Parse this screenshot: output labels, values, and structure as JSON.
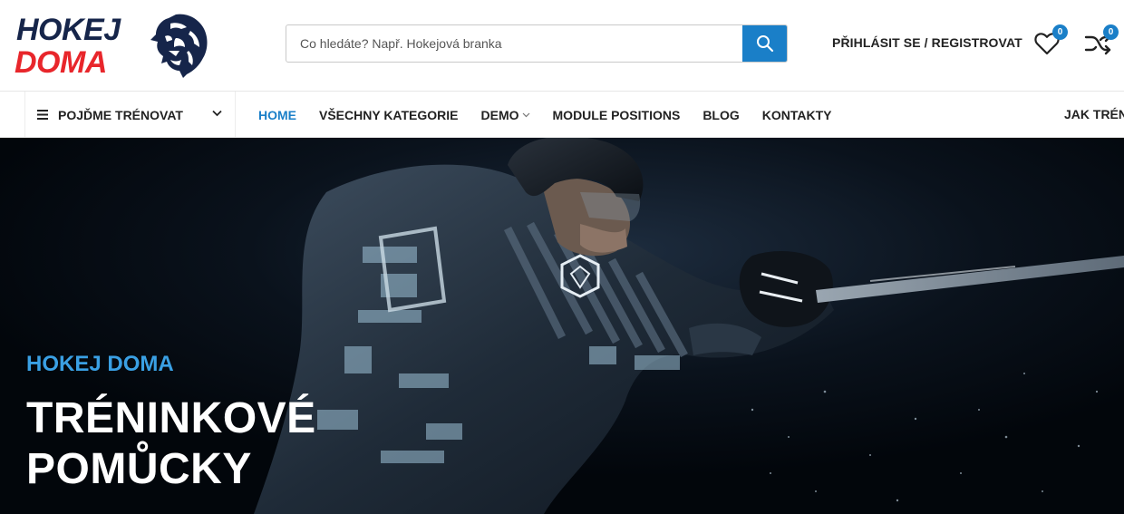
{
  "header": {
    "logo": {
      "line1": "HOKEJ",
      "line2": "DOMA",
      "mark_icon": "lion-head-icon"
    },
    "search": {
      "placeholder": "Co hledáte? Např. Hokejová branka",
      "button_icon": "search-icon"
    },
    "login_label": "PŘIHLÁSIT SE / REGISTROVAT",
    "wishlist": {
      "icon": "heart-icon",
      "count": "0"
    },
    "compare": {
      "icon": "shuffle-icon",
      "count": "0"
    }
  },
  "nav": {
    "categories_label": "POJĎME TRÉNOVAT",
    "items": [
      {
        "label": "HOME",
        "active": true
      },
      {
        "label": "VŠECHNY KATEGORIE"
      },
      {
        "label": "DEMO",
        "has_dropdown": true
      },
      {
        "label": "MODULE POSITIONS"
      },
      {
        "label": "BLOG"
      },
      {
        "label": "KONTAKTY"
      }
    ],
    "right_item": "JAK TRÉN"
  },
  "hero": {
    "subtitle": "HOKEJ DOMA",
    "title_line1": "TRÉNINKOVÉ",
    "title_line2": "POMŮCKY",
    "image": "hockey-player-shooting-photo"
  },
  "colors": {
    "brand_navy": "#16254a",
    "brand_red": "#e8262b",
    "accent_blue": "#1a7fc8",
    "hero_subtitle": "#3aa0e4"
  }
}
